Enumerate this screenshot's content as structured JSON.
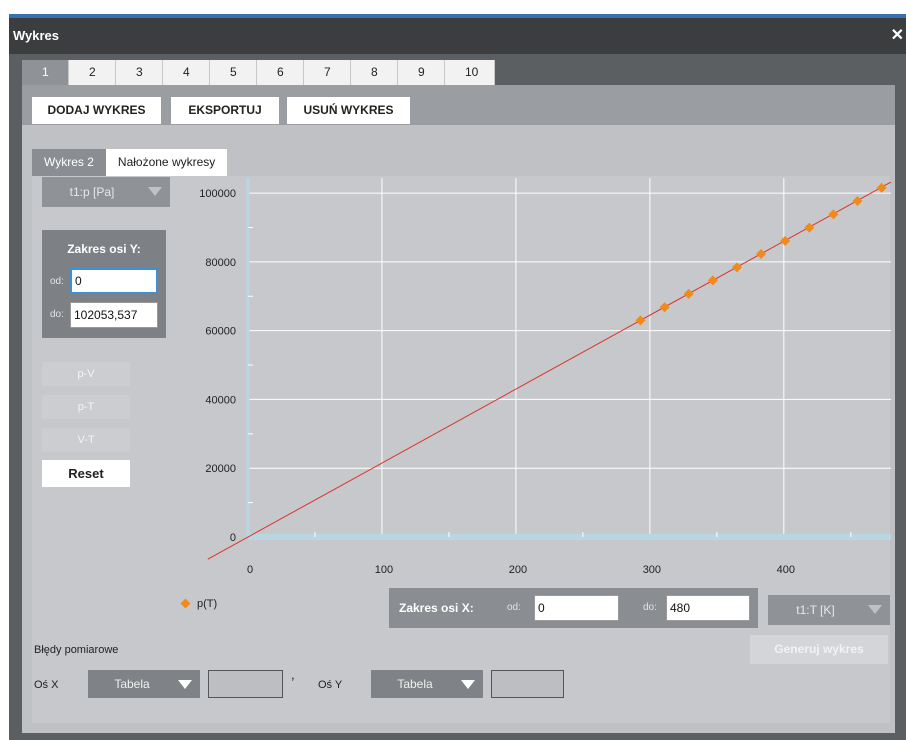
{
  "window": {
    "title": "Wykres"
  },
  "num_tabs": [
    "1",
    "2",
    "3",
    "4",
    "5",
    "6",
    "7",
    "8",
    "9",
    "10"
  ],
  "actions": {
    "add": "DODAJ WYKRES",
    "export": "EKSPORTUJ",
    "remove": "USUŃ WYKRES"
  },
  "sub_tabs": [
    "Wykres 2",
    "Nałożone wykresy"
  ],
  "y_selector": "t1:p [Pa]",
  "y_range": {
    "title": "Zakres osi Y:",
    "from_label": "od:",
    "from_value": "0",
    "to_label": "do:",
    "to_value": "102053,537"
  },
  "view_buttons": [
    "p-V",
    "p-T",
    "V-T"
  ],
  "reset_label": "Reset",
  "legend_label": "p(T)",
  "x_range": {
    "title": "Zakres osi X:",
    "from_label": "od:",
    "from_value": "0",
    "to_label": "do:",
    "to_value": "480"
  },
  "x_selector": "t1:T [K]",
  "generate_label": "Generuj wykres",
  "errors_label": "Błędy pomiarowe",
  "axis_x_label": "Oś X",
  "axis_y_label": "Oś Y",
  "table_option": "Tabela",
  "colors": {
    "line": "#d9342b",
    "marker": "#f28a17",
    "plot_bg": "#c6c8cb",
    "grid": "#ffffff",
    "axis": "#b9d6e3"
  },
  "chart_data": {
    "type": "scatter",
    "series": [
      {
        "name": "p(T)",
        "x": [
          293,
          311,
          329,
          347,
          365,
          383,
          401,
          419,
          437,
          455,
          473
        ],
        "y": [
          63000,
          66800,
          70700,
          74600,
          78400,
          82300,
          86100,
          89900,
          93800,
          97700,
          101500
        ]
      }
    ],
    "trend_line": {
      "slope": 215,
      "intercept": 0
    },
    "xlim": [
      0,
      480
    ],
    "ylim": [
      0,
      102053.537
    ],
    "x_ticks": [
      0,
      100,
      200,
      300,
      400
    ],
    "y_ticks": [
      0,
      20000,
      40000,
      60000,
      80000,
      100000
    ],
    "grid": true
  }
}
